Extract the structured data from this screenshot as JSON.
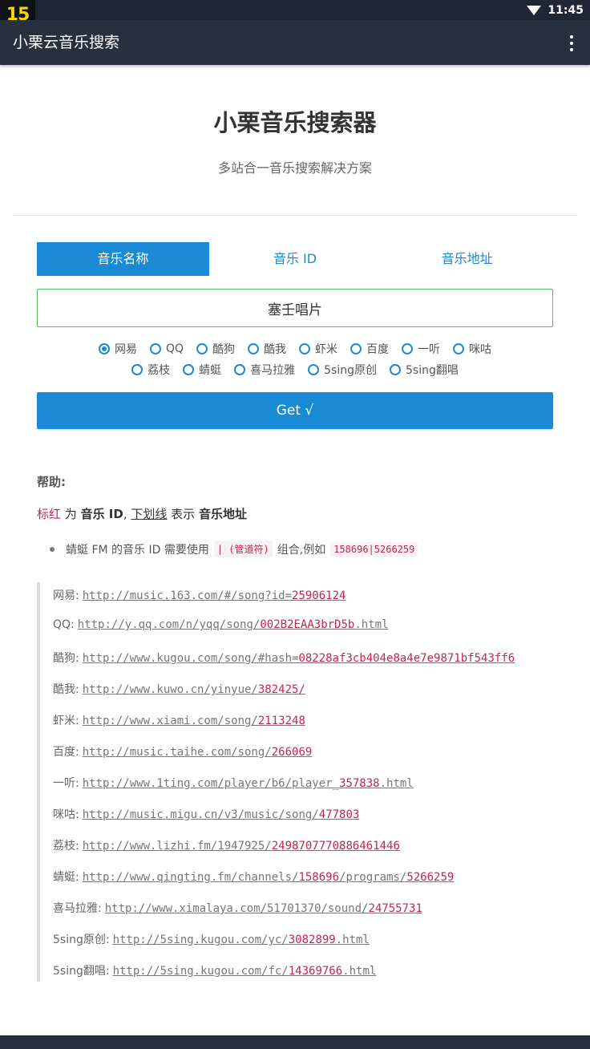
{
  "status": {
    "badge": "15",
    "time": "11:45"
  },
  "app_bar": {
    "title": "小栗云音乐搜索"
  },
  "hero": {
    "title": "小栗音乐搜索器",
    "subtitle": "多站合一音乐搜索解决方案"
  },
  "tabs": [
    {
      "label": "音乐名称",
      "active": true
    },
    {
      "label": "音乐 ID",
      "active": false
    },
    {
      "label": "音乐地址",
      "active": false
    }
  ],
  "search": {
    "value": "塞壬唱片"
  },
  "sources_row1": [
    "网易",
    "QQ",
    "酷狗",
    "酷我",
    "虾米",
    "百度",
    "一听",
    "咪咕"
  ],
  "sources_row2": [
    "荔枝",
    "蜻蜓",
    "喜马拉雅",
    "5sing原创",
    "5sing翻唱"
  ],
  "selected_source": "网易",
  "get_button": "Get √",
  "help": {
    "title": "帮助:",
    "legend_red": "标红",
    "legend_is": " 为 ",
    "legend_id": "音乐 ID",
    "legend_comma": ",",
    "legend_ul": "下划线",
    "legend_means": " 表示 ",
    "legend_addr": "音乐地址",
    "note_pre": "蜻蜓 FM 的音乐 ID 需要使用",
    "note_code1": "| (管道符)",
    "note_mid": "组合,例如",
    "note_code2": "158696|5266259"
  },
  "examples": [
    {
      "label": "网易:",
      "base": "http://music.163.com/#/song?id=",
      "id": "25906124",
      "tail": ""
    },
    {
      "label": "QQ:",
      "base": "http://y.qq.com/n/yqq/song/",
      "id": "002B2EAA3brD5b",
      "tail": ".html"
    },
    {
      "label": "酷狗:",
      "base": "http://www.kugou.com/song/#hash=",
      "id": "08228af3cb404e8a4e7e9871bf543ff6",
      "tail": ""
    },
    {
      "label": "酷我:",
      "base": "http://www.kuwo.cn/yinyue/",
      "id": "382425/",
      "tail": ""
    },
    {
      "label": "虾米:",
      "base": "http://www.xiami.com/song/",
      "id": "2113248",
      "tail": ""
    },
    {
      "label": "百度:",
      "base": "http://music.taihe.com/song/",
      "id": "266069",
      "tail": ""
    },
    {
      "label": "一听:",
      "base": "http://www.1ting.com/player/b6/player_",
      "id": "357838",
      "tail": ".html"
    },
    {
      "label": "咪咕:",
      "base": "http://music.migu.cn/v3/music/song/",
      "id": "477803",
      "tail": ""
    },
    {
      "label": "荔枝:",
      "base": "http://www.lizhi.fm/1947925/",
      "id": "2498707770886461446",
      "tail": ""
    },
    {
      "label": "蜻蜓:",
      "base": "http://www.qingting.fm/channels/",
      "id": "158696",
      "mid": "/programs/",
      "id2": "5266259",
      "tail": ""
    },
    {
      "label": "喜马拉雅:",
      "base": "http://www.ximalaya.com/51701370/sound/",
      "id": "24755731",
      "tail": ""
    },
    {
      "label": "5sing原创:",
      "base": "http://5sing.kugou.com/yc/",
      "id": "3082899",
      "tail": ".html"
    },
    {
      "label": "5sing翻唱:",
      "base": "http://5sing.kugou.com/fc/",
      "id": "14369766",
      "tail": ".html"
    }
  ],
  "colors": {
    "appbar": "#27313e",
    "accent": "#1a8ad4",
    "highlight": "#c7254e",
    "input_border": "#5cb85c"
  }
}
